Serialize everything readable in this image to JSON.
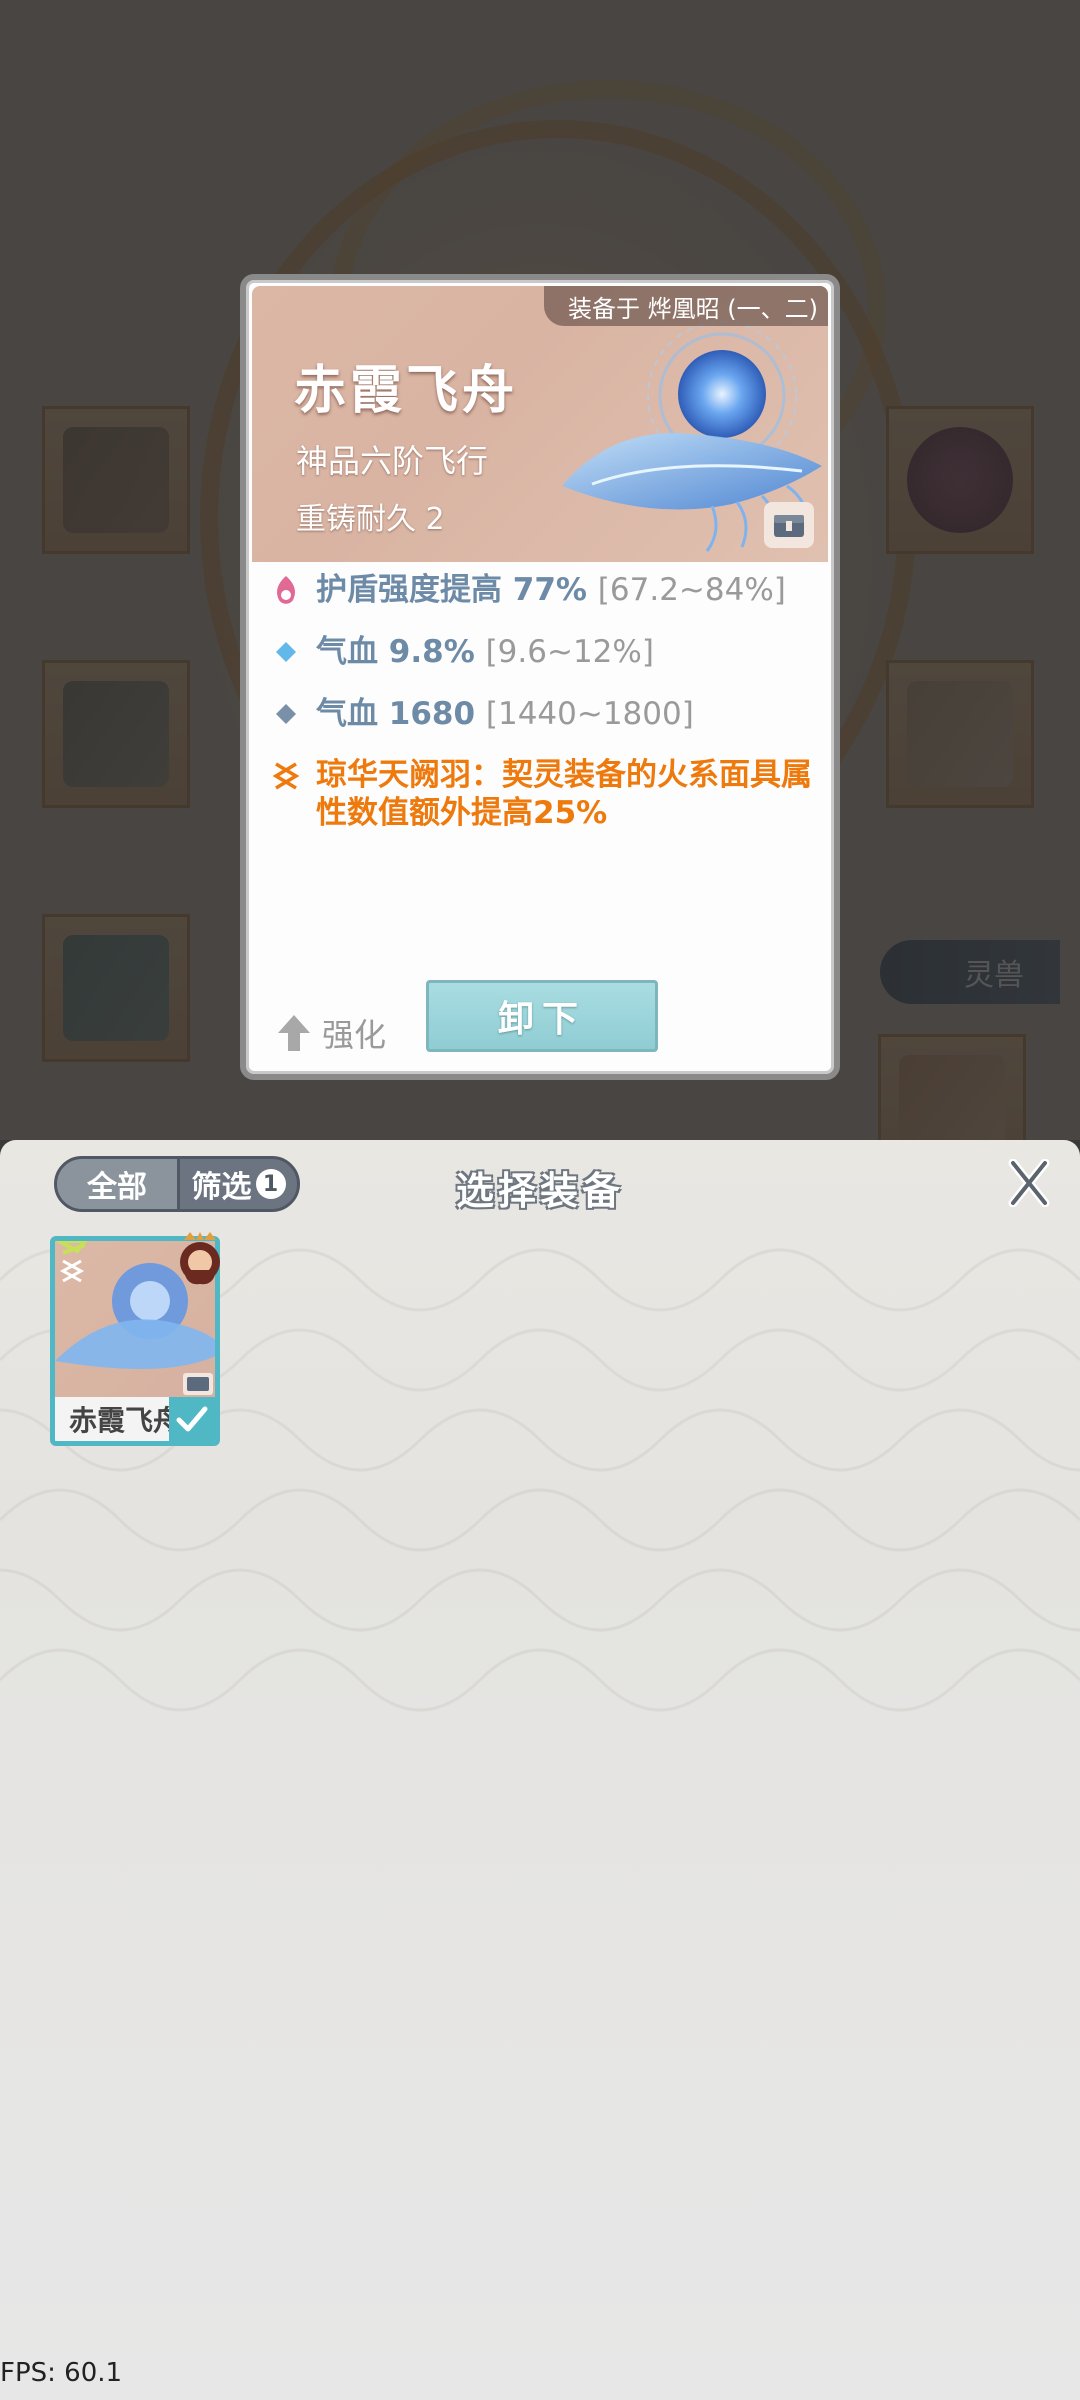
{
  "card": {
    "equipped_label": "装备于 烨凰昭 (一、二)",
    "name": "赤霞飞舟",
    "grade": "神品六阶飞行",
    "durability": "重铸耐久 2",
    "stats": [
      {
        "icon": "fire-mask-icon",
        "text": "护盾强度提高 77%",
        "range": "[67.2~84%]",
        "color": "#d9668f"
      },
      {
        "icon": "diamond-light-icon",
        "text": "气血 9.8%",
        "range": "[9.6~12%]",
        "color": "#6fb3e0"
      },
      {
        "icon": "diamond-dark-icon",
        "text": "气血 1680",
        "range": "[1440~1800]",
        "color": "#7a90a8"
      }
    ],
    "special": {
      "icon": "special-effect-icon",
      "text": "琼华天阙羽：契灵装备的火系面具属性数值额外提高25%"
    },
    "strengthen_label": "强化",
    "unequip_label": "卸下"
  },
  "background": {
    "lingshou_tab": "灵兽"
  },
  "panel": {
    "tab_all": "全部",
    "tab_filter": "筛选",
    "filter_count": "1",
    "title": "选择装备",
    "items": [
      {
        "name": "赤霞飞舟",
        "selected": true
      }
    ]
  },
  "fps": "FPS: 60.1"
}
